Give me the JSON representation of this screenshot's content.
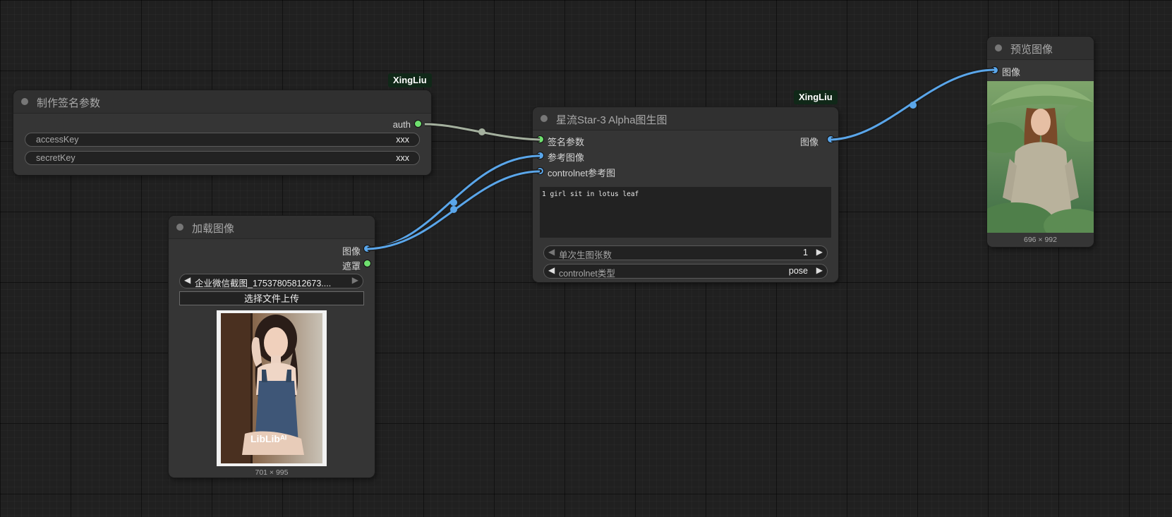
{
  "nodes": {
    "sign": {
      "title": "制作签名参数",
      "badge": "XingLiu",
      "output_auth": "auth",
      "access_key_label": "accessKey",
      "access_key_value": "xxx",
      "secret_key_label": "secretKey",
      "secret_key_value": "xxx"
    },
    "load": {
      "title": "加载图像",
      "output_image": "图像",
      "output_mask": "遮罩",
      "file_value": "企业微信截图_17537805812673....",
      "upload_button": "选择文件上传",
      "image_caption": "701 × 995",
      "watermark": "LibLibᴬᴵ"
    },
    "star": {
      "title": "星流Star-3 Alpha图生图",
      "badge": "XingLiu",
      "input_sign": "签名参数",
      "input_ref": "参考图像",
      "input_controlnet": "controlnet参考图",
      "output_image": "图像",
      "prompt": "1 girl sit in lotus leaf",
      "count_label": "单次生图张数",
      "count_value": "1",
      "cn_type_label": "controlnet类型",
      "cn_type_value": "pose"
    },
    "preview": {
      "title": "预览图像",
      "input_image": "图像",
      "image_caption": "696 × 992"
    }
  },
  "colors": {
    "auth_wire": "#a4b09e",
    "image_wire": "#5aa6ea",
    "green_slot": "#6fe06f",
    "blue_slot": "#5aa6ea",
    "badge_bg": "#102818"
  },
  "icons": [
    "left-arrow-icon",
    "right-arrow-icon"
  ]
}
